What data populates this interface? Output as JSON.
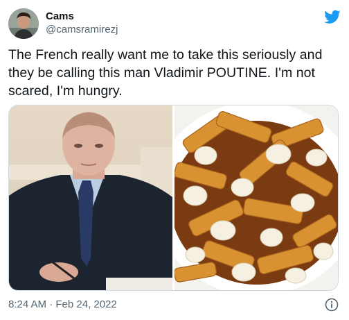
{
  "user": {
    "display_name": "Cams",
    "handle": "@camsramirezj"
  },
  "tweet": {
    "text": "The French really want me to take this seriously and they be calling this man Vladimir POUTINE. I'm not scared, I'm hungry.",
    "timestamp": "8:24 AM · Feb 24, 2022"
  },
  "icons": {
    "brand": "twitter-bird-icon",
    "info": "info-icon"
  },
  "colors": {
    "brand_blue": "#1d9bf0",
    "secondary_text": "#536471",
    "primary_text": "#0f1419"
  }
}
